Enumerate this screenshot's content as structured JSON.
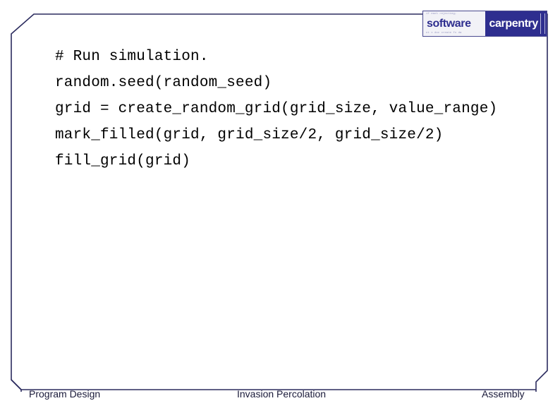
{
  "slide": {
    "logo": {
      "word_left": "software",
      "word_right": "carpentry",
      "micro_top": "if each rejecting;",
      "micro_bottom": "nt x doc create fx da"
    },
    "code": {
      "lines": [
        "# Run simulation.",
        "random.seed(random_seed)",
        "grid = create_random_grid(grid_size, value_range)",
        "mark_filled(grid, grid_size/2, grid_size/2)",
        "fill_grid(grid)"
      ]
    },
    "footer": {
      "left": "Program Design",
      "center": "Invasion Percolation",
      "right": "Assembly"
    },
    "colors": {
      "frame_border": "#2b2b5e",
      "logo_blue": "#2e2e8f",
      "text": "#000000",
      "footer_text": "#1a1a3a",
      "background": "#ffffff"
    }
  }
}
